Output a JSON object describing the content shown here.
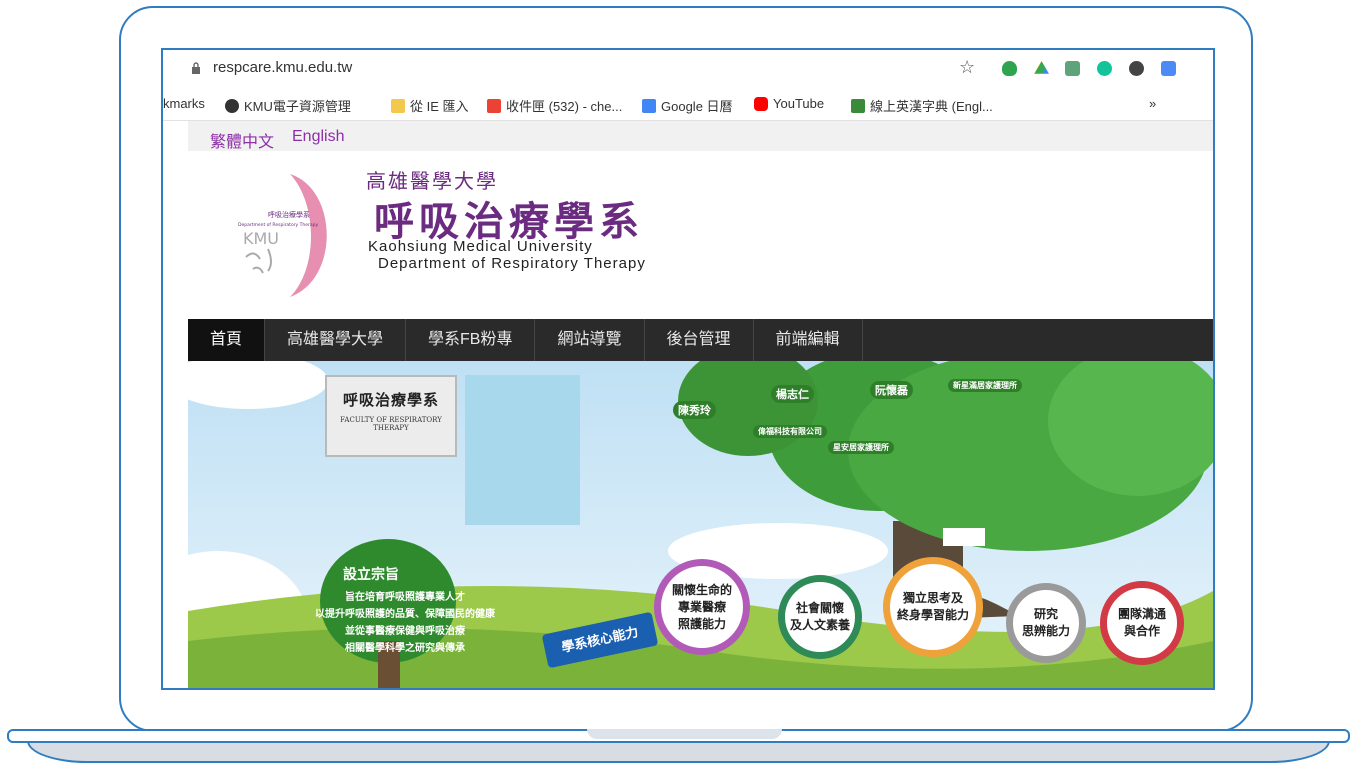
{
  "browser": {
    "url": "respcare.kmu.edu.tw",
    "bookmarks": [
      {
        "label": "kmarks"
      },
      {
        "label": "KMU電子資源管理"
      },
      {
        "label": "從 IE 匯入"
      },
      {
        "label": "收件匣 (532) - che..."
      },
      {
        "label": "Google 日曆"
      },
      {
        "label": "YouTube"
      },
      {
        "label": "線上英漢字典 (Engl..."
      },
      {
        "label": "»"
      }
    ]
  },
  "lang": {
    "zh": "繁體中文",
    "en": "English"
  },
  "header": {
    "univ": "高雄醫學大學",
    "dept": "呼吸治療學系",
    "en_univ": "Kaohsiung Medical University",
    "en_dept": "Department of Respiratory Therapy",
    "logo_text": "呼吸治療學系",
    "logo_en": "Department of Respiratory Therapy",
    "logo_kmu": "KMU"
  },
  "nav": [
    {
      "label": "首頁"
    },
    {
      "label": "高雄醫學大學"
    },
    {
      "label": "學系FB粉專"
    },
    {
      "label": "網站導覽"
    },
    {
      "label": "後台管理"
    },
    {
      "label": "前端編輯"
    }
  ],
  "banner": {
    "faculty_title": "呼吸治療學系",
    "faculty_en": "FACULTY OF RESPIRATORY THERAPY",
    "mission_title": "設立宗旨",
    "mission_lines": [
      "旨在培育呼吸照護專業人才",
      "以提升呼吸照護的品質、保障國民的健康",
      "並從事醫療保健與呼吸治療",
      "相關醫學科學之研究與傳承"
    ],
    "core": "學系核心能力",
    "badges": [
      {
        "l1": "關懷生命的",
        "l2": "專業醫療",
        "l3": "照護能力",
        "color": "#b15ab8"
      },
      {
        "l1": "社會關懷",
        "l2": "及人文素養",
        "l3": "",
        "color": "#2e8b57"
      },
      {
        "l1": "獨立思考及",
        "l2": "終身學習能力",
        "l3": "",
        "color": "#f0a23a"
      },
      {
        "l1": "研究",
        "l2": "思辨能力",
        "l3": "",
        "color": "#9a9a9a"
      },
      {
        "l1": "團隊溝通",
        "l2": "與合作",
        "l3": "",
        "color": "#d23a46"
      }
    ],
    "leaves": [
      {
        "label": "陳秀玲"
      },
      {
        "label": "楊志仁"
      },
      {
        "label": "阮懷磊"
      },
      {
        "label": "新星滿居家護理所"
      },
      {
        "label": "偉福科技有限公司"
      },
      {
        "label": "星安居家護理所"
      }
    ]
  }
}
